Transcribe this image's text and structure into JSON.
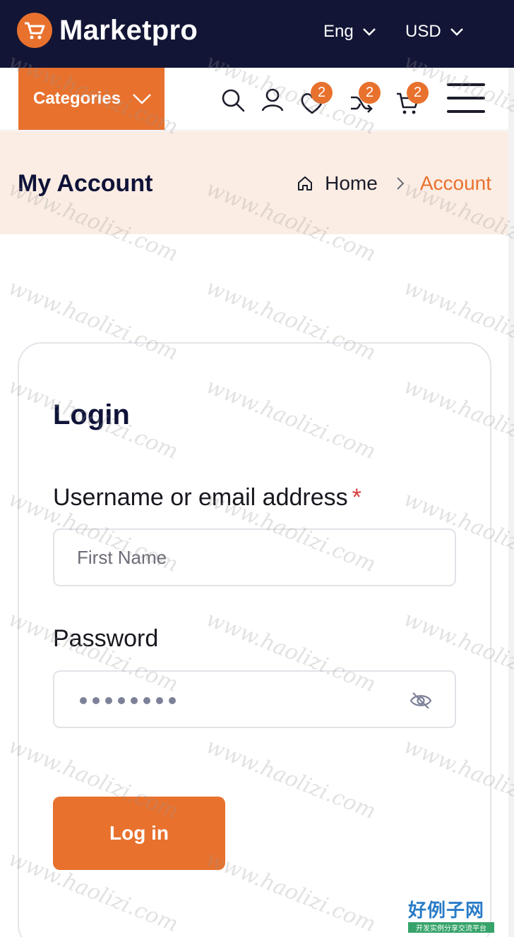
{
  "header": {
    "brand": "Marketpro",
    "language": "Eng",
    "currency": "USD"
  },
  "nav": {
    "categories_label": "Categories",
    "wishlist_count": "2",
    "compare_count": "2",
    "cart_count": "2"
  },
  "breadcrumb": {
    "page_title": "My Account",
    "home": "Home",
    "current": "Account"
  },
  "login": {
    "title": "Login",
    "username_label": "Username or email address",
    "required_mark": "*",
    "username_placeholder": "First Name",
    "password_label": "Password",
    "submit_label": "Log in"
  },
  "watermark": {
    "text": "www.haolizi.com",
    "corner_brand": "好例子网",
    "corner_sub": "开发实例分享交流平台"
  },
  "colors": {
    "accent": "#e8712e",
    "topbar": "#121535",
    "banner": "#fbede4"
  }
}
